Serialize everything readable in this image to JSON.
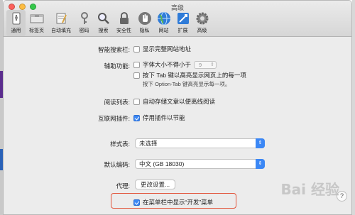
{
  "window": {
    "title": "高级"
  },
  "toolbar": {
    "items": [
      {
        "label": "通用",
        "icon": "general-icon"
      },
      {
        "label": "标签页",
        "icon": "tabs-icon"
      },
      {
        "label": "自动填充",
        "icon": "autofill-icon"
      },
      {
        "label": "密码",
        "icon": "key-icon"
      },
      {
        "label": "搜索",
        "icon": "search-icon"
      },
      {
        "label": "安全性",
        "icon": "lock-icon"
      },
      {
        "label": "隐私",
        "icon": "hand-icon"
      },
      {
        "label": "网站",
        "icon": "globe-icon"
      },
      {
        "label": "扩展",
        "icon": "puzzle-icon"
      },
      {
        "label": "高级",
        "icon": "gear-icon"
      }
    ],
    "active_index": 0
  },
  "settings": {
    "smart_search": {
      "label": "智能搜索栏:",
      "option": "显示完整网站地址",
      "checked": false
    },
    "accessibility": {
      "label": "辅助功能:",
      "font_option": "字体大小不得小于",
      "font_size": "9",
      "tab_option": "按下 Tab 键以高亮显示网页上的每一项",
      "tab_hint": "按下 Option-Tab 键高亮显示每一项。",
      "font_checked": false,
      "tab_checked": false
    },
    "reading_list": {
      "label": "阅读列表:",
      "option": "自动存储文章以便离线阅读",
      "checked": false
    },
    "plugins": {
      "label": "互联网插件:",
      "option": "停用插件以节能",
      "checked": true
    },
    "stylesheet": {
      "label": "样式表:",
      "value": "未选择"
    },
    "encoding": {
      "label": "默认编码:",
      "value": "中文 (GB 18030)"
    },
    "proxies": {
      "label": "代理:",
      "button": "更改设置..."
    },
    "develop_menu": {
      "option": "在菜单栏中显示“开发”菜单",
      "checked": true
    }
  },
  "help": {
    "label": "?"
  },
  "watermark": {
    "text": "Bai  经验"
  },
  "colors": {
    "accent": "#3b87f5",
    "highlight_box": "#e2543a"
  }
}
